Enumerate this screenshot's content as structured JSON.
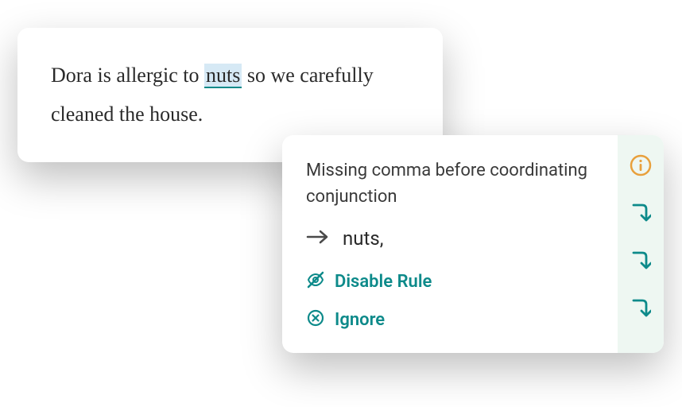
{
  "editor": {
    "before": "Dora is allergic to ",
    "highlighted": "nuts",
    "after": " so we carefully cleaned the house."
  },
  "suggestion": {
    "title": "Missing comma before coordinating conjunction",
    "replacement": "nuts,",
    "actions": {
      "disable": "Disable Rule",
      "ignore": "Ignore"
    }
  }
}
